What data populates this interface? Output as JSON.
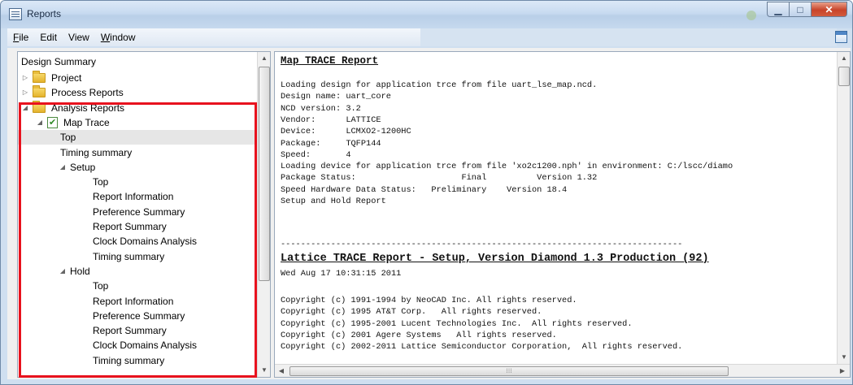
{
  "window": {
    "title": "Reports"
  },
  "menu": [
    {
      "label": "File",
      "u": "F",
      "rest": "ile"
    },
    {
      "label": "Edit",
      "u": "",
      "rest": "Edit"
    },
    {
      "label": "View",
      "u": "",
      "rest": "View"
    },
    {
      "label": "Window",
      "u": "W",
      "rest": "indow"
    }
  ],
  "tree": {
    "header": "Design Summary",
    "items": [
      {
        "label": "Project",
        "level": 0,
        "arrow": "collapsed",
        "icon": "folder-icon"
      },
      {
        "label": "Process Reports",
        "level": 0,
        "arrow": "collapsed",
        "icon": "folder-icon"
      },
      {
        "label": "Analysis Reports",
        "level": 0,
        "arrow": "expanded",
        "icon": "folder-icon"
      },
      {
        "label": "Map Trace",
        "level": 1,
        "arrow": "expanded",
        "icon": "map-trace-icon"
      },
      {
        "label": "Top",
        "level": 2,
        "arrow": "",
        "icon": "",
        "selected": true
      },
      {
        "label": "Timing summary",
        "level": 2,
        "arrow": "",
        "icon": ""
      },
      {
        "label": "Setup",
        "level": 2,
        "arrow": "expanded",
        "icon": ""
      },
      {
        "label": "Top",
        "level": 3,
        "arrow": "",
        "icon": ""
      },
      {
        "label": "Report Information",
        "level": 3,
        "arrow": "",
        "icon": ""
      },
      {
        "label": "Preference Summary",
        "level": 3,
        "arrow": "",
        "icon": ""
      },
      {
        "label": "Report Summary",
        "level": 3,
        "arrow": "",
        "icon": ""
      },
      {
        "label": "Clock Domains Analysis",
        "level": 3,
        "arrow": "",
        "icon": ""
      },
      {
        "label": "Timing summary",
        "level": 3,
        "arrow": "",
        "icon": ""
      },
      {
        "label": "Hold",
        "level": 2,
        "arrow": "expanded",
        "icon": ""
      },
      {
        "label": "Top",
        "level": 3,
        "arrow": "",
        "icon": ""
      },
      {
        "label": "Report Information",
        "level": 3,
        "arrow": "",
        "icon": ""
      },
      {
        "label": "Preference Summary",
        "level": 3,
        "arrow": "",
        "icon": ""
      },
      {
        "label": "Report Summary",
        "level": 3,
        "arrow": "",
        "icon": ""
      },
      {
        "label": "Clock Domains Analysis",
        "level": 3,
        "arrow": "",
        "icon": ""
      },
      {
        "label": "Timing summary",
        "level": 3,
        "arrow": "",
        "icon": ""
      }
    ]
  },
  "report": {
    "title": "Map TRACE Report",
    "lines": [
      "Loading design for application trce from file uart_lse_map.ncd.",
      "Design name: uart_core",
      "NCD version: 3.2",
      "Vendor:      LATTICE",
      "Device:      LCMXO2-1200HC",
      "Package:     TQFP144",
      "Speed:       4",
      "Loading device for application trce from file 'xo2c1200.nph' in environment: C:/lscc/diamo",
      "Package Status:                     Final          Version 1.32",
      "Speed Hardware Data Status:   Preliminary    Version 18.4",
      "Setup and Hold Report"
    ],
    "separator": "--------------------------------------------------------------------------------",
    "heading": "Lattice TRACE Report - Setup, Version Diamond_1.3_Production (92)",
    "date": "Wed Aug 17 10:31:15 2011",
    "copyright": [
      "Copyright (c) 1991-1994 by NeoCAD Inc. All rights reserved.",
      "Copyright (c) 1995 AT&T Corp.   All rights reserved.",
      "Copyright (c) 1995-2001 Lucent Technologies Inc.  All rights reserved.",
      "Copyright (c) 2001 Agere Systems   All rights reserved.",
      "Copyright (c) 2002-2011 Lattice Semiconductor Corporation,  All rights reserved."
    ]
  },
  "colors": {
    "highlight": "#e8121e",
    "title_bar": "#c7daf0",
    "close_button": "#c8442a"
  },
  "icons": {
    "app": "report-window-icon",
    "minimize": "minimize-icon",
    "maximize": "maximize-icon",
    "close": "close-icon",
    "dock": "dock-panel-icon",
    "folder": "folder-icon",
    "trace": "map-trace-icon"
  }
}
